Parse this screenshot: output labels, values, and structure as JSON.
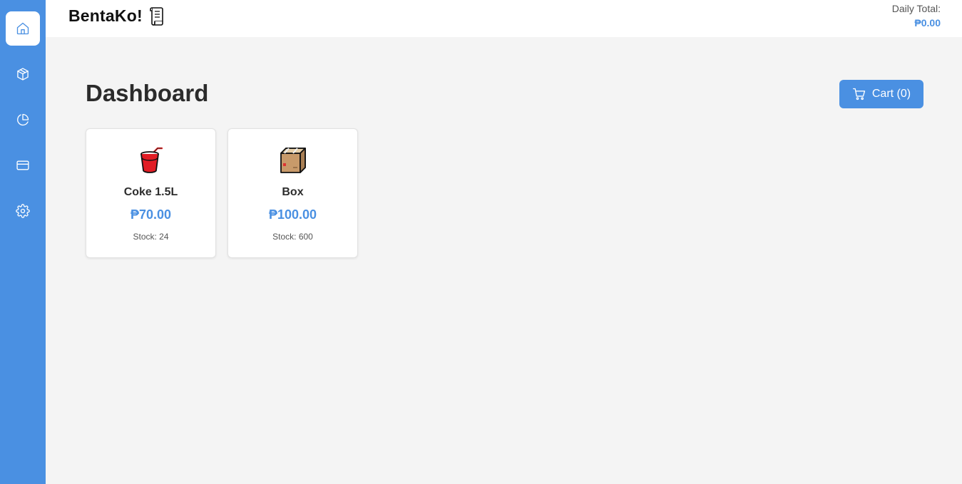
{
  "app": {
    "brand": "BentaKo!",
    "brand_icon": "scroll-icon",
    "accent_color": "#4a90e2"
  },
  "sidebar": {
    "items": [
      {
        "icon": "home-icon",
        "active": true
      },
      {
        "icon": "package-icon",
        "active": false
      },
      {
        "icon": "pie-chart-icon",
        "active": false
      },
      {
        "icon": "credit-card-icon",
        "active": false
      },
      {
        "icon": "gear-icon",
        "active": false
      }
    ]
  },
  "header": {
    "daily_total_label": "Daily Total:",
    "daily_total_value": "₱0.00"
  },
  "main": {
    "title": "Dashboard",
    "cart_label": "Cart (0)",
    "products": [
      {
        "icon": "cup-with-straw-icon",
        "name": "Coke 1.5L",
        "price": "₱70.00",
        "stock": "Stock: 24"
      },
      {
        "icon": "package-box-icon",
        "name": "Box",
        "price": "₱100.00",
        "stock": "Stock: 600"
      }
    ]
  }
}
